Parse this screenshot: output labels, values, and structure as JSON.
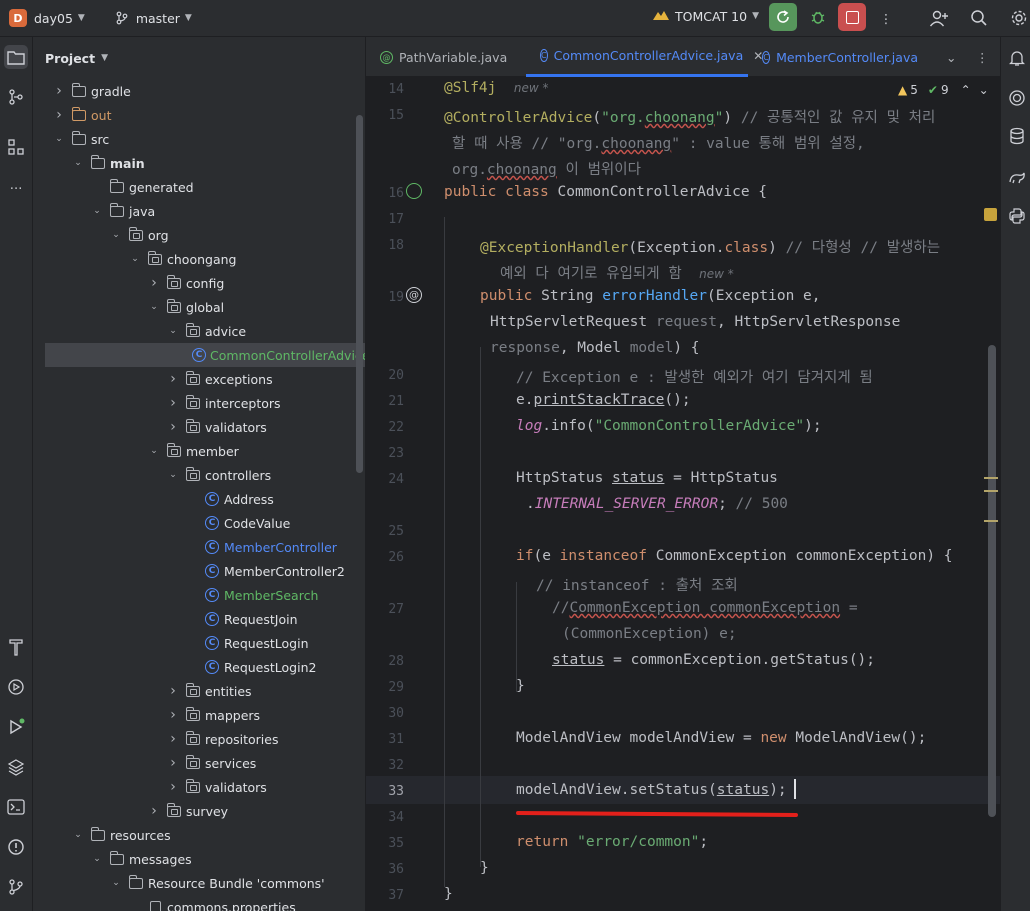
{
  "topbar": {
    "project_badge": "D",
    "project_name": "day05",
    "branch": "master",
    "run_config": "TOMCAT 10"
  },
  "project_panel": {
    "title": "Project",
    "tree": [
      {
        "label": "gradle",
        "depth": 0,
        "expanded": false,
        "kind": "folder"
      },
      {
        "label": "out",
        "depth": 0,
        "expanded": false,
        "kind": "folder-out"
      },
      {
        "label": "src",
        "depth": 0,
        "expanded": true,
        "kind": "folder"
      },
      {
        "label": "main",
        "depth": 1,
        "expanded": true,
        "kind": "folder-bold"
      },
      {
        "label": "generated",
        "depth": 2,
        "expanded": null,
        "kind": "folder"
      },
      {
        "label": "java",
        "depth": 2,
        "expanded": true,
        "kind": "folder"
      },
      {
        "label": "org",
        "depth": 3,
        "expanded": true,
        "kind": "package"
      },
      {
        "label": "choongang",
        "depth": 4,
        "expanded": true,
        "kind": "package"
      },
      {
        "label": "config",
        "depth": 5,
        "expanded": false,
        "kind": "package"
      },
      {
        "label": "global",
        "depth": 5,
        "expanded": true,
        "kind": "package"
      },
      {
        "label": "advice",
        "depth": 6,
        "expanded": true,
        "kind": "package"
      },
      {
        "label": "CommonControllerAdvice",
        "depth": 7,
        "expanded": null,
        "kind": "class-green",
        "selected": true
      },
      {
        "label": "exceptions",
        "depth": 6,
        "expanded": false,
        "kind": "package"
      },
      {
        "label": "interceptors",
        "depth": 6,
        "expanded": false,
        "kind": "package"
      },
      {
        "label": "validators",
        "depth": 6,
        "expanded": false,
        "kind": "package"
      },
      {
        "label": "member",
        "depth": 5,
        "expanded": true,
        "kind": "package"
      },
      {
        "label": "controllers",
        "depth": 6,
        "expanded": true,
        "kind": "package"
      },
      {
        "label": "Address",
        "depth": 7,
        "expanded": null,
        "kind": "class"
      },
      {
        "label": "CodeValue",
        "depth": 7,
        "expanded": null,
        "kind": "class"
      },
      {
        "label": "MemberController",
        "depth": 7,
        "expanded": null,
        "kind": "class-blue"
      },
      {
        "label": "MemberController2",
        "depth": 7,
        "expanded": null,
        "kind": "class"
      },
      {
        "label": "MemberSearch",
        "depth": 7,
        "expanded": null,
        "kind": "class-green"
      },
      {
        "label": "RequestJoin",
        "depth": 7,
        "expanded": null,
        "kind": "class"
      },
      {
        "label": "RequestLogin",
        "depth": 7,
        "expanded": null,
        "kind": "class"
      },
      {
        "label": "RequestLogin2",
        "depth": 7,
        "expanded": null,
        "kind": "class"
      },
      {
        "label": "entities",
        "depth": 6,
        "expanded": false,
        "kind": "package"
      },
      {
        "label": "mappers",
        "depth": 6,
        "expanded": false,
        "kind": "package"
      },
      {
        "label": "repositories",
        "depth": 6,
        "expanded": false,
        "kind": "package"
      },
      {
        "label": "services",
        "depth": 6,
        "expanded": false,
        "kind": "package"
      },
      {
        "label": "validators",
        "depth": 6,
        "expanded": false,
        "kind": "package"
      },
      {
        "label": "survey",
        "depth": 5,
        "expanded": false,
        "kind": "package"
      },
      {
        "label": "resources",
        "depth": 1,
        "expanded": true,
        "kind": "folder"
      },
      {
        "label": "messages",
        "depth": 2,
        "expanded": true,
        "kind": "folder"
      },
      {
        "label": "Resource Bundle 'commons'",
        "depth": 3,
        "expanded": true,
        "kind": "folder"
      },
      {
        "label": "commons.properties",
        "depth": 4,
        "expanded": null,
        "kind": "file"
      }
    ]
  },
  "tabs": [
    {
      "label": "PathVariable.java",
      "active": false
    },
    {
      "label": "CommonControllerAdvice.java",
      "active": true
    },
    {
      "label": "MemberController.java",
      "active": false
    }
  ],
  "inspections": {
    "warnings": "5",
    "ok": "9"
  },
  "editor": {
    "line_numbers": [
      "14",
      "15",
      "16",
      "17",
      "18",
      "19",
      "20",
      "21",
      "22",
      "23",
      "24",
      "25",
      "26",
      "27",
      "28",
      "29",
      "30",
      "31",
      "32",
      "33",
      "34",
      "35",
      "36",
      "37"
    ],
    "hint_new": "new *"
  },
  "colors": {
    "accent": "#3574f0",
    "keyword": "#cf8e6d",
    "annotation": "#b3ae60",
    "string": "#6aab73",
    "comment": "#7a7e85",
    "underline_red": "#e3201b"
  }
}
